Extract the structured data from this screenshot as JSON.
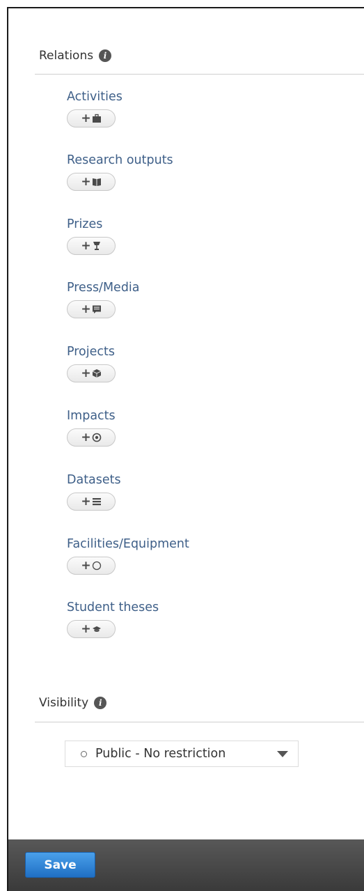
{
  "relations": {
    "title": "Relations",
    "items": [
      {
        "label": "Activities",
        "icon": "briefcase-icon"
      },
      {
        "label": "Research outputs",
        "icon": "book-icon"
      },
      {
        "label": "Prizes",
        "icon": "trophy-icon"
      },
      {
        "label": "Press/Media",
        "icon": "newspaper-icon"
      },
      {
        "label": "Projects",
        "icon": "cube-icon"
      },
      {
        "label": "Impacts",
        "icon": "target-icon"
      },
      {
        "label": "Datasets",
        "icon": "list-icon"
      },
      {
        "label": "Facilities/Equipment",
        "icon": "circle-outline-icon"
      },
      {
        "label": "Student theses",
        "icon": "graduation-cap-icon"
      }
    ]
  },
  "visibility": {
    "title": "Visibility",
    "selected": "Public - No restriction"
  },
  "footer": {
    "save_label": "Save"
  },
  "colors": {
    "link": "#3e5f88",
    "save_button": "#2d80d6",
    "footer_bar": "#4a4a4a"
  }
}
